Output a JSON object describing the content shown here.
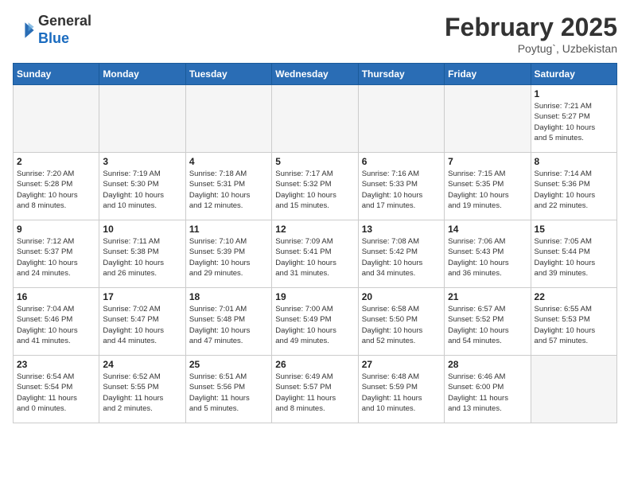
{
  "header": {
    "logo_general": "General",
    "logo_blue": "Blue",
    "month_year": "February 2025",
    "location": "Poytug`, Uzbekistan"
  },
  "weekdays": [
    "Sunday",
    "Monday",
    "Tuesday",
    "Wednesday",
    "Thursday",
    "Friday",
    "Saturday"
  ],
  "weeks": [
    [
      {
        "day": "",
        "info": ""
      },
      {
        "day": "",
        "info": ""
      },
      {
        "day": "",
        "info": ""
      },
      {
        "day": "",
        "info": ""
      },
      {
        "day": "",
        "info": ""
      },
      {
        "day": "",
        "info": ""
      },
      {
        "day": "1",
        "info": "Sunrise: 7:21 AM\nSunset: 5:27 PM\nDaylight: 10 hours\nand 5 minutes."
      }
    ],
    [
      {
        "day": "2",
        "info": "Sunrise: 7:20 AM\nSunset: 5:28 PM\nDaylight: 10 hours\nand 8 minutes."
      },
      {
        "day": "3",
        "info": "Sunrise: 7:19 AM\nSunset: 5:30 PM\nDaylight: 10 hours\nand 10 minutes."
      },
      {
        "day": "4",
        "info": "Sunrise: 7:18 AM\nSunset: 5:31 PM\nDaylight: 10 hours\nand 12 minutes."
      },
      {
        "day": "5",
        "info": "Sunrise: 7:17 AM\nSunset: 5:32 PM\nDaylight: 10 hours\nand 15 minutes."
      },
      {
        "day": "6",
        "info": "Sunrise: 7:16 AM\nSunset: 5:33 PM\nDaylight: 10 hours\nand 17 minutes."
      },
      {
        "day": "7",
        "info": "Sunrise: 7:15 AM\nSunset: 5:35 PM\nDaylight: 10 hours\nand 19 minutes."
      },
      {
        "day": "8",
        "info": "Sunrise: 7:14 AM\nSunset: 5:36 PM\nDaylight: 10 hours\nand 22 minutes."
      }
    ],
    [
      {
        "day": "9",
        "info": "Sunrise: 7:12 AM\nSunset: 5:37 PM\nDaylight: 10 hours\nand 24 minutes."
      },
      {
        "day": "10",
        "info": "Sunrise: 7:11 AM\nSunset: 5:38 PM\nDaylight: 10 hours\nand 26 minutes."
      },
      {
        "day": "11",
        "info": "Sunrise: 7:10 AM\nSunset: 5:39 PM\nDaylight: 10 hours\nand 29 minutes."
      },
      {
        "day": "12",
        "info": "Sunrise: 7:09 AM\nSunset: 5:41 PM\nDaylight: 10 hours\nand 31 minutes."
      },
      {
        "day": "13",
        "info": "Sunrise: 7:08 AM\nSunset: 5:42 PM\nDaylight: 10 hours\nand 34 minutes."
      },
      {
        "day": "14",
        "info": "Sunrise: 7:06 AM\nSunset: 5:43 PM\nDaylight: 10 hours\nand 36 minutes."
      },
      {
        "day": "15",
        "info": "Sunrise: 7:05 AM\nSunset: 5:44 PM\nDaylight: 10 hours\nand 39 minutes."
      }
    ],
    [
      {
        "day": "16",
        "info": "Sunrise: 7:04 AM\nSunset: 5:46 PM\nDaylight: 10 hours\nand 41 minutes."
      },
      {
        "day": "17",
        "info": "Sunrise: 7:02 AM\nSunset: 5:47 PM\nDaylight: 10 hours\nand 44 minutes."
      },
      {
        "day": "18",
        "info": "Sunrise: 7:01 AM\nSunset: 5:48 PM\nDaylight: 10 hours\nand 47 minutes."
      },
      {
        "day": "19",
        "info": "Sunrise: 7:00 AM\nSunset: 5:49 PM\nDaylight: 10 hours\nand 49 minutes."
      },
      {
        "day": "20",
        "info": "Sunrise: 6:58 AM\nSunset: 5:50 PM\nDaylight: 10 hours\nand 52 minutes."
      },
      {
        "day": "21",
        "info": "Sunrise: 6:57 AM\nSunset: 5:52 PM\nDaylight: 10 hours\nand 54 minutes."
      },
      {
        "day": "22",
        "info": "Sunrise: 6:55 AM\nSunset: 5:53 PM\nDaylight: 10 hours\nand 57 minutes."
      }
    ],
    [
      {
        "day": "23",
        "info": "Sunrise: 6:54 AM\nSunset: 5:54 PM\nDaylight: 11 hours\nand 0 minutes."
      },
      {
        "day": "24",
        "info": "Sunrise: 6:52 AM\nSunset: 5:55 PM\nDaylight: 11 hours\nand 2 minutes."
      },
      {
        "day": "25",
        "info": "Sunrise: 6:51 AM\nSunset: 5:56 PM\nDaylight: 11 hours\nand 5 minutes."
      },
      {
        "day": "26",
        "info": "Sunrise: 6:49 AM\nSunset: 5:57 PM\nDaylight: 11 hours\nand 8 minutes."
      },
      {
        "day": "27",
        "info": "Sunrise: 6:48 AM\nSunset: 5:59 PM\nDaylight: 11 hours\nand 10 minutes."
      },
      {
        "day": "28",
        "info": "Sunrise: 6:46 AM\nSunset: 6:00 PM\nDaylight: 11 hours\nand 13 minutes."
      },
      {
        "day": "",
        "info": ""
      }
    ]
  ]
}
